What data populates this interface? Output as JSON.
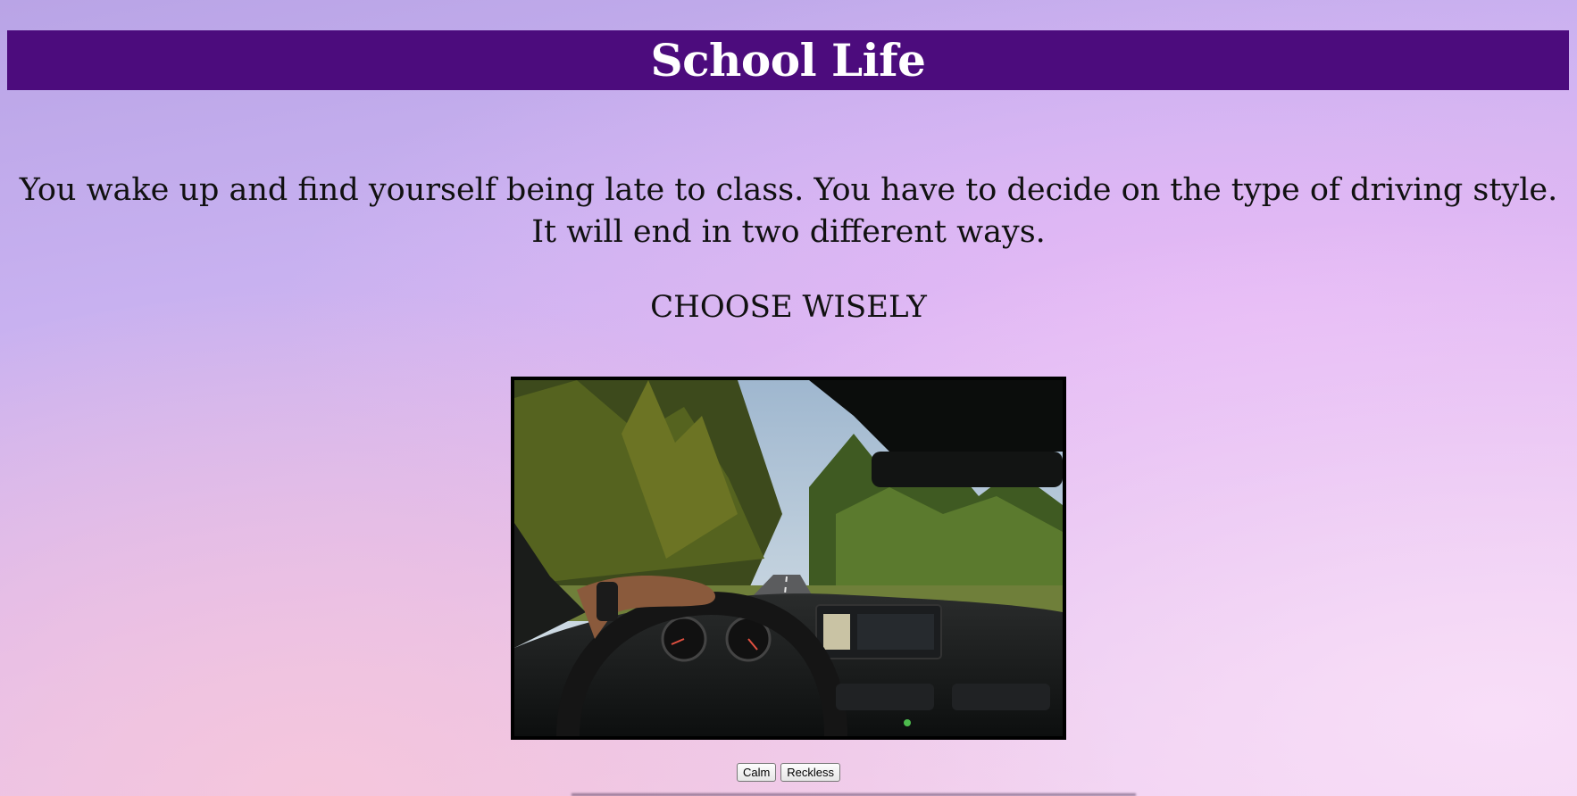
{
  "header": {
    "title": "School Life"
  },
  "story": {
    "intro": "You wake up and find yourself being late to class. You have to decide on the type of driving style. It will end in two different ways.",
    "prompt": "CHOOSE WISELY"
  },
  "image": {
    "alt": "Driver's view from inside a car on a forest road"
  },
  "choices": {
    "calm_label": "Calm",
    "reckless_label": "Reckless"
  },
  "colors": {
    "header_bg": "#4c0c7d",
    "header_text": "#ffffff",
    "body_text": "#111111"
  }
}
